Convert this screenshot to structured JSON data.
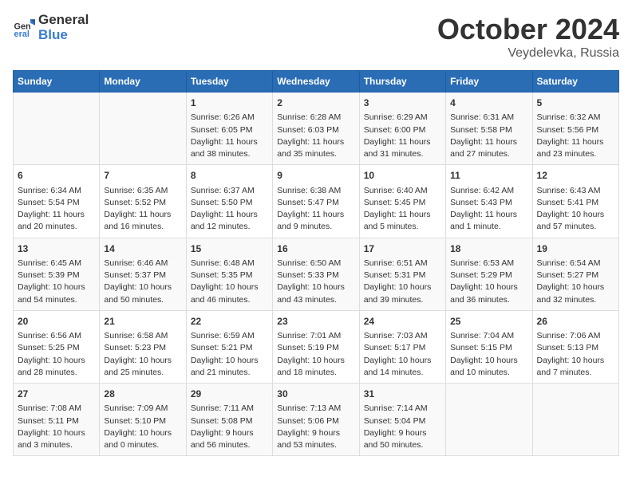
{
  "header": {
    "logo_general": "General",
    "logo_blue": "Blue",
    "title": "October 2024",
    "location": "Veydelevka, Russia"
  },
  "columns": [
    "Sunday",
    "Monday",
    "Tuesday",
    "Wednesday",
    "Thursday",
    "Friday",
    "Saturday"
  ],
  "weeks": [
    [
      {
        "day": "",
        "content": ""
      },
      {
        "day": "",
        "content": ""
      },
      {
        "day": "1",
        "content": "Sunrise: 6:26 AM\nSunset: 6:05 PM\nDaylight: 11 hours and 38 minutes."
      },
      {
        "day": "2",
        "content": "Sunrise: 6:28 AM\nSunset: 6:03 PM\nDaylight: 11 hours and 35 minutes."
      },
      {
        "day": "3",
        "content": "Sunrise: 6:29 AM\nSunset: 6:00 PM\nDaylight: 11 hours and 31 minutes."
      },
      {
        "day": "4",
        "content": "Sunrise: 6:31 AM\nSunset: 5:58 PM\nDaylight: 11 hours and 27 minutes."
      },
      {
        "day": "5",
        "content": "Sunrise: 6:32 AM\nSunset: 5:56 PM\nDaylight: 11 hours and 23 minutes."
      }
    ],
    [
      {
        "day": "6",
        "content": "Sunrise: 6:34 AM\nSunset: 5:54 PM\nDaylight: 11 hours and 20 minutes."
      },
      {
        "day": "7",
        "content": "Sunrise: 6:35 AM\nSunset: 5:52 PM\nDaylight: 11 hours and 16 minutes."
      },
      {
        "day": "8",
        "content": "Sunrise: 6:37 AM\nSunset: 5:50 PM\nDaylight: 11 hours and 12 minutes."
      },
      {
        "day": "9",
        "content": "Sunrise: 6:38 AM\nSunset: 5:47 PM\nDaylight: 11 hours and 9 minutes."
      },
      {
        "day": "10",
        "content": "Sunrise: 6:40 AM\nSunset: 5:45 PM\nDaylight: 11 hours and 5 minutes."
      },
      {
        "day": "11",
        "content": "Sunrise: 6:42 AM\nSunset: 5:43 PM\nDaylight: 11 hours and 1 minute."
      },
      {
        "day": "12",
        "content": "Sunrise: 6:43 AM\nSunset: 5:41 PM\nDaylight: 10 hours and 57 minutes."
      }
    ],
    [
      {
        "day": "13",
        "content": "Sunrise: 6:45 AM\nSunset: 5:39 PM\nDaylight: 10 hours and 54 minutes."
      },
      {
        "day": "14",
        "content": "Sunrise: 6:46 AM\nSunset: 5:37 PM\nDaylight: 10 hours and 50 minutes."
      },
      {
        "day": "15",
        "content": "Sunrise: 6:48 AM\nSunset: 5:35 PM\nDaylight: 10 hours and 46 minutes."
      },
      {
        "day": "16",
        "content": "Sunrise: 6:50 AM\nSunset: 5:33 PM\nDaylight: 10 hours and 43 minutes."
      },
      {
        "day": "17",
        "content": "Sunrise: 6:51 AM\nSunset: 5:31 PM\nDaylight: 10 hours and 39 minutes."
      },
      {
        "day": "18",
        "content": "Sunrise: 6:53 AM\nSunset: 5:29 PM\nDaylight: 10 hours and 36 minutes."
      },
      {
        "day": "19",
        "content": "Sunrise: 6:54 AM\nSunset: 5:27 PM\nDaylight: 10 hours and 32 minutes."
      }
    ],
    [
      {
        "day": "20",
        "content": "Sunrise: 6:56 AM\nSunset: 5:25 PM\nDaylight: 10 hours and 28 minutes."
      },
      {
        "day": "21",
        "content": "Sunrise: 6:58 AM\nSunset: 5:23 PM\nDaylight: 10 hours and 25 minutes."
      },
      {
        "day": "22",
        "content": "Sunrise: 6:59 AM\nSunset: 5:21 PM\nDaylight: 10 hours and 21 minutes."
      },
      {
        "day": "23",
        "content": "Sunrise: 7:01 AM\nSunset: 5:19 PM\nDaylight: 10 hours and 18 minutes."
      },
      {
        "day": "24",
        "content": "Sunrise: 7:03 AM\nSunset: 5:17 PM\nDaylight: 10 hours and 14 minutes."
      },
      {
        "day": "25",
        "content": "Sunrise: 7:04 AM\nSunset: 5:15 PM\nDaylight: 10 hours and 10 minutes."
      },
      {
        "day": "26",
        "content": "Sunrise: 7:06 AM\nSunset: 5:13 PM\nDaylight: 10 hours and 7 minutes."
      }
    ],
    [
      {
        "day": "27",
        "content": "Sunrise: 7:08 AM\nSunset: 5:11 PM\nDaylight: 10 hours and 3 minutes."
      },
      {
        "day": "28",
        "content": "Sunrise: 7:09 AM\nSunset: 5:10 PM\nDaylight: 10 hours and 0 minutes."
      },
      {
        "day": "29",
        "content": "Sunrise: 7:11 AM\nSunset: 5:08 PM\nDaylight: 9 hours and 56 minutes."
      },
      {
        "day": "30",
        "content": "Sunrise: 7:13 AM\nSunset: 5:06 PM\nDaylight: 9 hours and 53 minutes."
      },
      {
        "day": "31",
        "content": "Sunrise: 7:14 AM\nSunset: 5:04 PM\nDaylight: 9 hours and 50 minutes."
      },
      {
        "day": "",
        "content": ""
      },
      {
        "day": "",
        "content": ""
      }
    ]
  ]
}
